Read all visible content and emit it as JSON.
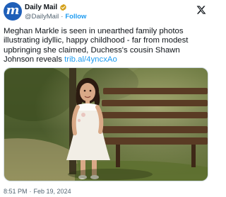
{
  "post": {
    "author": {
      "display_name": "Daily Mail",
      "handle": "@DailyMail",
      "separator": "·",
      "follow_label": "Follow",
      "avatar_letter": "m",
      "avatar_color": "#1f5fb8",
      "verified": true
    },
    "platform_icon": "x-logo-icon",
    "text": "Meghan Markle is seen in unearthed family photos illustrating idyllic, happy childhood - far from modest upbringing she claimed, Duchess's cousin Shawn Johnson reveals ",
    "link_text": "trib.al/4yncxAo",
    "media": {
      "description_icon": "photo-girl-on-bench"
    },
    "time": "8:51 PM",
    "date_separator": "·",
    "date": "Feb 19, 2024"
  },
  "colors": {
    "text": "#0f1419",
    "muted": "#536471",
    "accent": "#1d9bf0"
  }
}
